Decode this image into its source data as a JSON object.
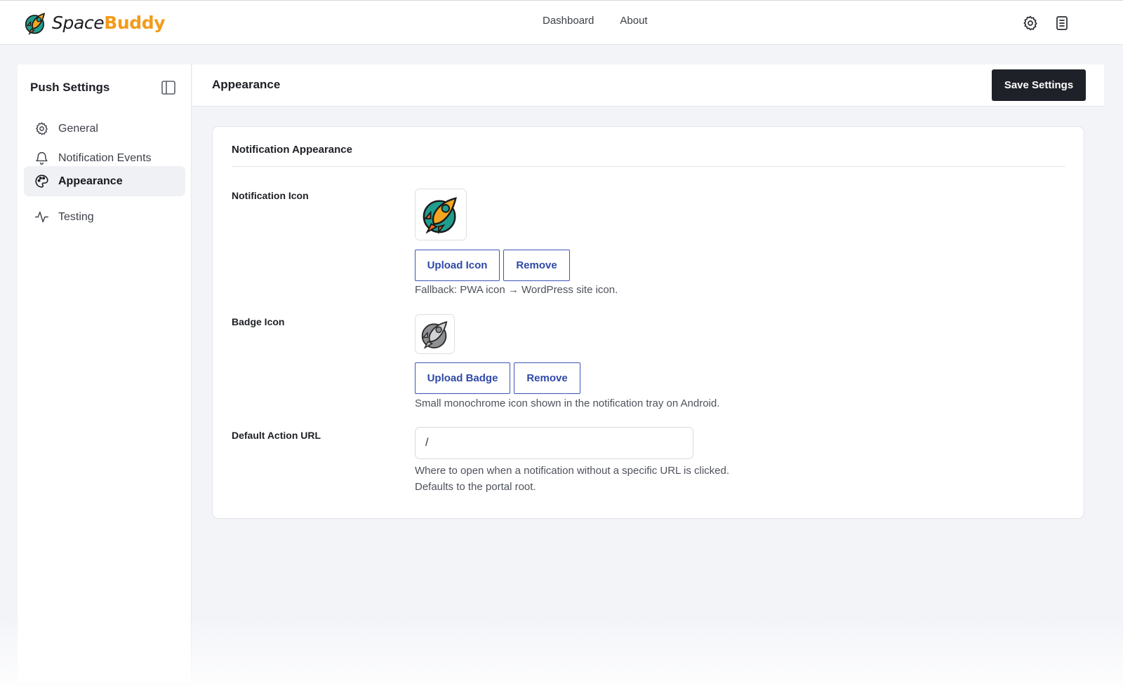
{
  "app": {
    "logo_part1": "Space",
    "logo_part2": "Buddy",
    "brand_color": "#f39a1b"
  },
  "topnav": {
    "items": [
      {
        "label": "Dashboard"
      },
      {
        "label": "About"
      }
    ],
    "icons": [
      "gear-icon",
      "document-icon"
    ]
  },
  "sidebar": {
    "title": "Push Settings",
    "collapse_icon": "sidebar-toggle-icon",
    "items": [
      {
        "label": "General",
        "icon": "gear-icon",
        "active": false
      },
      {
        "label": "Notification Events",
        "icon": "bell-icon",
        "active": false
      },
      {
        "label": "Appearance",
        "icon": "palette-icon",
        "active": true
      },
      {
        "label": "Testing",
        "icon": "activity-icon",
        "active": false
      }
    ]
  },
  "main": {
    "title": "Appearance",
    "save_label": "Save Settings",
    "card": {
      "title": "Notification Appearance",
      "notification_icon": {
        "label": "Notification Icon",
        "upload_label": "Upload Icon",
        "remove_label": "Remove",
        "help": "Fallback: PWA icon → WordPress site icon."
      },
      "badge_icon": {
        "label": "Badge Icon",
        "upload_label": "Upload Badge",
        "remove_label": "Remove",
        "help": "Small monochrome icon shown in the notification tray on Android."
      },
      "default_url": {
        "label": "Default Action URL",
        "value": "/",
        "help_line1": "Where to open when a notification without a specific URL is clicked.",
        "help_line2": "Defaults to the portal root."
      }
    }
  },
  "colors": {
    "accent": "#2f49a8",
    "primary_button": "#1f2129",
    "background": "#f3f4f8"
  }
}
